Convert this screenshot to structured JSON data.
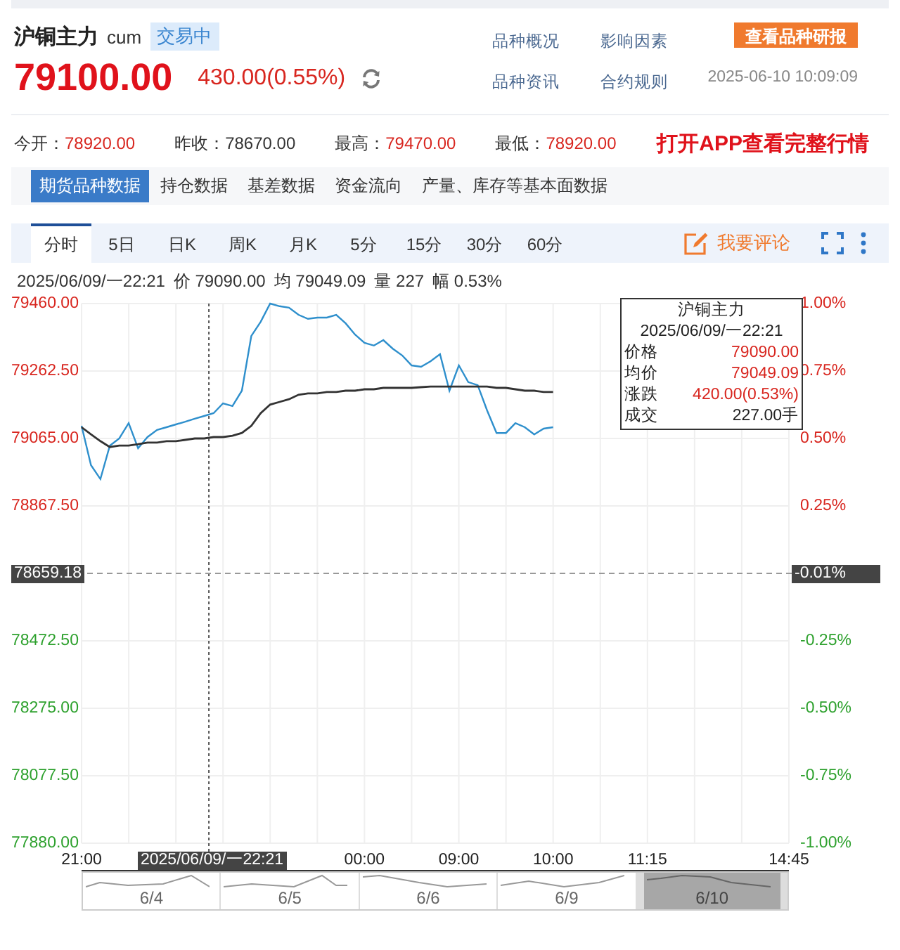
{
  "header": {
    "name": "沪铜主力",
    "code": "cum",
    "status": "交易中",
    "price": "79100.00",
    "change": "430.00(0.55%)",
    "links": [
      "品种概况",
      "影响因素",
      "品种资讯",
      "合约规则"
    ],
    "report_button": "查看品种研报",
    "timestamp": "2025-06-10 10:09:09"
  },
  "stats": [
    {
      "label": "今开：",
      "value": "78920.00",
      "color": "#d8261f"
    },
    {
      "label": "昨收：",
      "value": "78670.00",
      "color": "#333333"
    },
    {
      "label": "最高：",
      "value": "79470.00",
      "color": "#d8261f"
    },
    {
      "label": "最低：",
      "value": "78920.00",
      "color": "#d8261f"
    }
  ],
  "app_link": "打开APP查看完整行情",
  "data_tabs": [
    {
      "label": "期货品种数据",
      "selected": true
    },
    {
      "label": "持仓数据",
      "selected": false
    },
    {
      "label": "基差数据",
      "selected": false
    },
    {
      "label": "资金流向",
      "selected": false
    },
    {
      "label": "产量、库存等基本面数据",
      "selected": false
    }
  ],
  "chart_toolbar": {
    "periods": [
      {
        "label": "分时",
        "selected": true
      },
      {
        "label": "5日",
        "selected": false
      },
      {
        "label": "日K",
        "selected": false
      },
      {
        "label": "周K",
        "selected": false
      },
      {
        "label": "月K",
        "selected": false
      },
      {
        "label": "5分",
        "selected": false
      },
      {
        "label": "15分",
        "selected": false
      },
      {
        "label": "30分",
        "selected": false
      },
      {
        "label": "60分",
        "selected": false
      }
    ],
    "comment_button": "我要评论"
  },
  "info_line": [
    "2025/06/09/一22:21",
    "价 79090.00",
    "均 79049.09",
    "量 227",
    "幅 0.53%"
  ],
  "chart": {
    "percent_axis": [
      {
        "label": "1.00%",
        "color": "#d8261f"
      },
      {
        "label": "0.75%",
        "color": "#d8261f"
      },
      {
        "label": "0.50%",
        "color": "#d8261f"
      },
      {
        "label": "0.25%",
        "color": "#d8261f"
      },
      {
        "label": "-0.25%",
        "color": "#2ea12e"
      },
      {
        "label": "-0.50%",
        "color": "#2ea12e"
      },
      {
        "label": "-0.75%",
        "color": "#2ea12e"
      },
      {
        "label": "-1.00%",
        "color": "#2ea12e"
      }
    ],
    "crosshair": {
      "price": "78659.18",
      "percent": "-0.01%",
      "time": "2025/06/09/一22:21"
    },
    "tooltip": {
      "title": "沪铜主力",
      "time": "2025/06/09/一22:21",
      "rows": [
        {
          "label": "价格",
          "value": "79090.00",
          "color": "#d8261f"
        },
        {
          "label": "均价",
          "value": "79049.09",
          "color": "#d8261f"
        },
        {
          "label": "涨跌",
          "value": "420.00(0.53%)",
          "color": "#d8261f"
        },
        {
          "label": "成交",
          "value": "227.00手",
          "color": "#222222"
        }
      ]
    },
    "navigator": [
      {
        "label": "6/4",
        "selected": false
      },
      {
        "label": "6/5",
        "selected": false
      },
      {
        "label": "6/6",
        "selected": false
      },
      {
        "label": "6/9",
        "selected": false
      },
      {
        "label": "6/10",
        "selected": true
      }
    ],
    "chart_data": {
      "type": "line",
      "categories": [
        "21:00",
        null,
        null,
        null,
        null,
        null,
        null,
        null,
        null,
        null,
        null,
        null,
        null,
        null,
        null,
        null,
        null,
        null,
        null,
        null,
        null,
        null,
        null,
        null,
        null,
        null,
        null,
        null,
        null,
        null,
        "00:00",
        null,
        null,
        null,
        null,
        null,
        null,
        null,
        null,
        null,
        "09:00",
        null,
        null,
        null,
        null,
        null,
        null,
        null,
        null,
        null,
        "10:00",
        null,
        null,
        null,
        null,
        null,
        null,
        null,
        null,
        null,
        "11:15",
        null,
        null,
        null,
        null,
        null,
        null,
        null,
        null,
        null,
        null,
        null,
        null,
        null,
        null,
        "14:45"
      ],
      "ylim": [
        77880,
        79460
      ],
      "grid": true,
      "ref_lines": [
        {
          "axis": "y",
          "value": 78670
        }
      ],
      "yticks": [
        {
          "value": 79460,
          "label": "79460.00"
        },
        {
          "value": 79262.5,
          "label": "79262.50"
        },
        {
          "value": 79065,
          "label": "79065.00"
        },
        {
          "value": 78867.5,
          "label": "78867.50"
        },
        {
          "value": 78472.5,
          "label": "78472.50"
        },
        {
          "value": 78275,
          "label": "78275.00"
        },
        {
          "value": 78077.5,
          "label": "78077.50"
        },
        {
          "value": 77880,
          "label": "77880.00"
        }
      ],
      "series": [
        {
          "color": "#2e8fcc",
          "values": [
            79102,
            78987,
            78946,
            79044,
            79065,
            79110,
            79036,
            79069,
            79090,
            79098,
            79106,
            79114,
            79123,
            79131,
            79139,
            79168,
            79160,
            79205,
            79365,
            79407,
            79460,
            79452,
            79448,
            79427,
            79415,
            79419,
            79419,
            79427,
            79402,
            79369,
            79345,
            79337,
            79353,
            79328,
            79308,
            79279,
            79275,
            79291,
            79312,
            79205,
            79279,
            79230,
            79221,
            79147,
            79081,
            79081,
            79110,
            79098,
            79077,
            79094,
            79098,
            null,
            null,
            null,
            null,
            null,
            null,
            null,
            null,
            null,
            null,
            null,
            null,
            null,
            null,
            null,
            null,
            null,
            null,
            null,
            null,
            null,
            null,
            null,
            null,
            null
          ]
        },
        {
          "color": "#333333",
          "values": [
            79098,
            79077,
            79057,
            79040,
            79044,
            79044,
            79048,
            79053,
            79053,
            79057,
            79057,
            79061,
            79065,
            79065,
            79069,
            79069,
            79073,
            79081,
            79102,
            79139,
            79164,
            79172,
            79180,
            79193,
            79197,
            79197,
            79201,
            79201,
            79205,
            79205,
            79209,
            79209,
            79213,
            79213,
            79213,
            79213,
            79215,
            79217,
            79217,
            79217,
            79217,
            79217,
            79217,
            79217,
            79213,
            79213,
            79209,
            79205,
            79205,
            79201,
            79201,
            null,
            null,
            null,
            null,
            null,
            null,
            null,
            null,
            null,
            null,
            null,
            null,
            null,
            null,
            null,
            null,
            null,
            null,
            null,
            null,
            null,
            null,
            null,
            null,
            null
          ]
        }
      ]
    }
  }
}
